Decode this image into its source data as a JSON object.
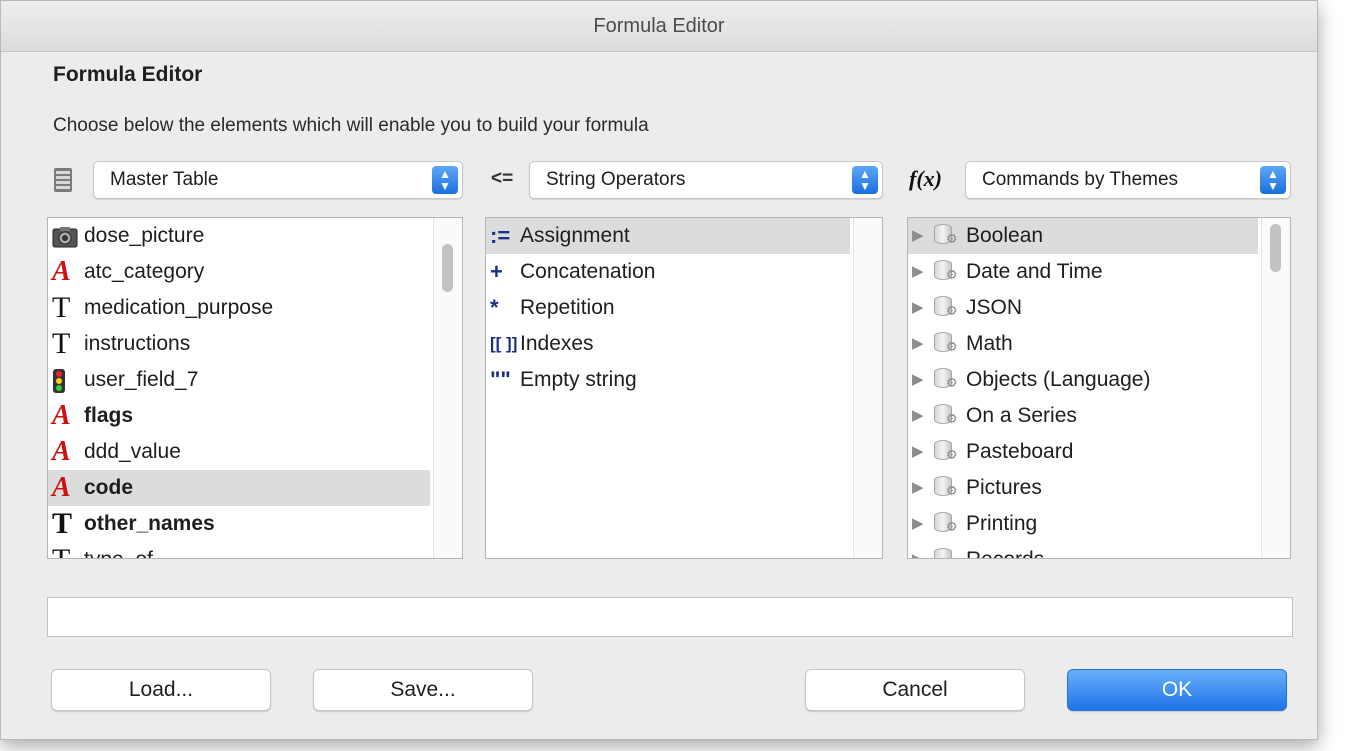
{
  "window": {
    "title": "Formula Editor"
  },
  "heading": "Formula Editor",
  "instructions": "Choose below the elements which will enable you to build your formula",
  "tables_popup": {
    "icon": "table-icon",
    "selected": "Master Table"
  },
  "operators_popup": {
    "icon_text": "<=",
    "selected": "String Operators"
  },
  "commands_popup": {
    "icon_text": "f(x)",
    "selected": "Commands by Themes"
  },
  "fields": [
    {
      "label": "dose_picture",
      "icon": "picture-field-icon"
    },
    {
      "label": "atc_category",
      "icon": "alpha-field-icon"
    },
    {
      "label": "medication_purpose",
      "icon": "text-field-icon"
    },
    {
      "label": "instructions",
      "icon": "text-field-icon"
    },
    {
      "label": "user_field_7",
      "icon": "traffic-light-icon"
    },
    {
      "label": "flags",
      "icon": "alpha-field-icon",
      "bold": true
    },
    {
      "label": "ddd_value",
      "icon": "alpha-field-icon"
    },
    {
      "label": "code",
      "icon": "alpha-field-icon",
      "bold": true,
      "selected": true
    },
    {
      "label": "other_names",
      "icon": "text-field-icon",
      "bold": true
    },
    {
      "label": "type_of",
      "icon": "text-field-icon"
    }
  ],
  "operators": [
    {
      "symbol": ":=",
      "label": "Assignment",
      "selected": true
    },
    {
      "symbol": "+",
      "label": "Concatenation"
    },
    {
      "symbol": "*",
      "label": "Repetition"
    },
    {
      "symbol": "[[ ]]",
      "label": "Indexes"
    },
    {
      "symbol": "\"\"",
      "label": "Empty string"
    }
  ],
  "themes": [
    {
      "label": "Boolean",
      "selected": true
    },
    {
      "label": "Date and Time"
    },
    {
      "label": "JSON"
    },
    {
      "label": "Math"
    },
    {
      "label": "Objects (Language)"
    },
    {
      "label": "On a Series"
    },
    {
      "label": "Pasteboard"
    },
    {
      "label": "Pictures"
    },
    {
      "label": "Printing"
    },
    {
      "label": "Records"
    }
  ],
  "formula": {
    "value": ""
  },
  "buttons": {
    "load": "Load...",
    "save": "Save...",
    "cancel": "Cancel",
    "ok": "OK"
  },
  "colors": {
    "accent": "#1d73e6",
    "selection": "#dcdcdc",
    "alpha_icon": "#cc1111"
  }
}
